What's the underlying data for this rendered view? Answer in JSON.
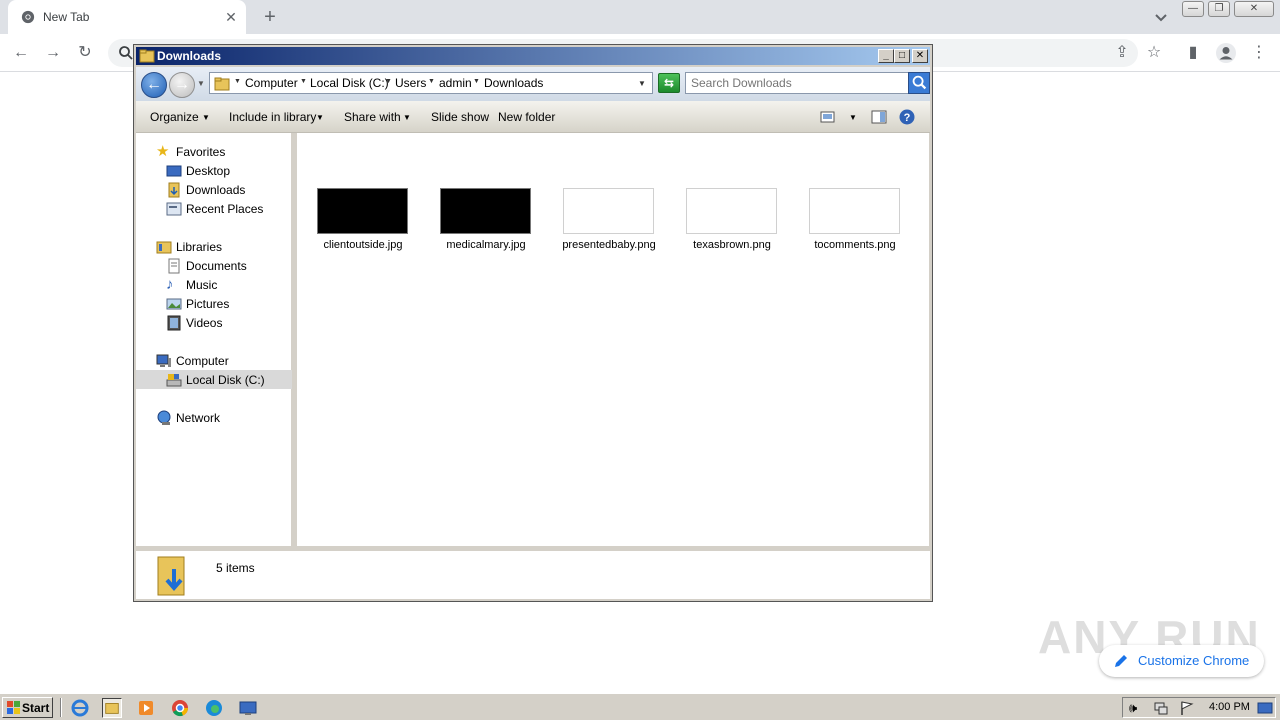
{
  "browser": {
    "tab_title": "New Tab",
    "customize_label": "Customize Chrome",
    "watermark": "ANY RUN"
  },
  "explorer": {
    "title": "Downloads",
    "breadcrumb": [
      "Computer",
      "Local Disk (C:)",
      "Users",
      "admin",
      "Downloads"
    ],
    "search_placeholder": "Search Downloads",
    "commands": {
      "organize": "Organize",
      "include_in_library": "Include in library",
      "share_with": "Share with",
      "slide_show": "Slide show",
      "new_folder": "New folder"
    },
    "nav": {
      "favorites": "Favorites",
      "desktop": "Desktop",
      "downloads": "Downloads",
      "recent_places": "Recent Places",
      "libraries": "Libraries",
      "documents": "Documents",
      "music": "Music",
      "pictures": "Pictures",
      "videos": "Videos",
      "computer": "Computer",
      "local_disk": "Local Disk (C:)",
      "network": "Network"
    },
    "files": [
      {
        "name": "clientoutside.jpg",
        "thumb": "dark"
      },
      {
        "name": "medicalmary.jpg",
        "thumb": "dark"
      },
      {
        "name": "presentedbaby.png",
        "thumb": "light"
      },
      {
        "name": "texasbrown.png",
        "thumb": "light"
      },
      {
        "name": "tocomments.png",
        "thumb": "light"
      }
    ],
    "item_count": "5 items"
  },
  "taskbar": {
    "start_label": "Start",
    "clock": "4:00 PM"
  },
  "colors": {
    "titlebar_start": "#0a246a",
    "titlebar_end": "#a6caf0",
    "chrome_blue": "#1a73e8",
    "classic_gray": "#d4d0c8"
  }
}
